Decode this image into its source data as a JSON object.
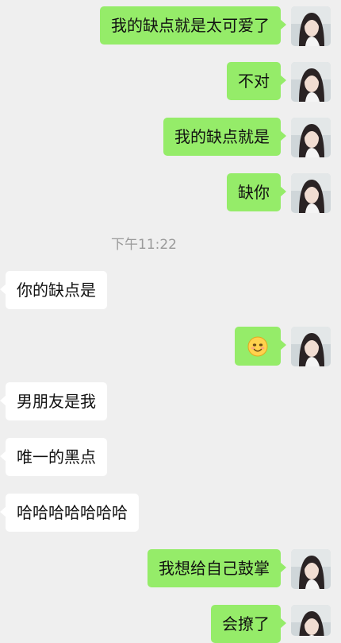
{
  "messages": [
    {
      "text": "我的缺点就是太可爱了"
    },
    {
      "text": "不对"
    },
    {
      "text": "我的缺点就是"
    },
    {
      "text": "缺你"
    },
    {
      "text": "你的缺点是"
    },
    {
      "emoji": "smiling-face-emoji"
    },
    {
      "text": "男朋友是我"
    },
    {
      "text": "唯一的黑点"
    },
    {
      "text": "哈哈哈哈哈哈哈"
    },
    {
      "text": "我想给自己鼓掌"
    },
    {
      "text": "会撩了"
    }
  ],
  "timestamp": "下午11:22",
  "colors": {
    "outgoing_bubble": "#95ec69",
    "incoming_bubble": "#ffffff",
    "background": "#efefef",
    "timestamp_text": "#9a9a9a"
  }
}
